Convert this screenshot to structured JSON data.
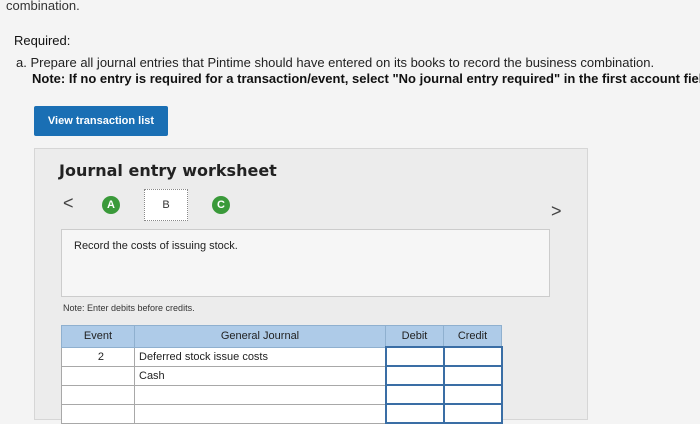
{
  "header": {
    "cut_text": "combination.",
    "required_title": "Required:",
    "item_a": "a. Prepare all journal entries that Pintime should have entered on its books to record the business combination.",
    "note": "Note: If no entry is required for a transaction/event, select \"No journal entry required\" in the first account field."
  },
  "buttons": {
    "view_transactions": "View transaction list"
  },
  "worksheet": {
    "title": "Journal entry worksheet",
    "nav_prev": "<",
    "nav_next": ">",
    "steps": [
      "A",
      "B",
      "C"
    ],
    "active_step": "B",
    "record_text": "Record the costs of issuing stock.",
    "note": "Note: Enter debits before credits."
  },
  "table": {
    "columns": [
      "Event",
      "General Journal",
      "Debit",
      "Credit"
    ],
    "rows": [
      {
        "event": "2",
        "account": "Deferred stock issue costs",
        "debit": "",
        "credit": ""
      },
      {
        "event": "",
        "account": "Cash",
        "debit": "",
        "credit": ""
      },
      {
        "event": "",
        "account": "",
        "debit": "",
        "credit": ""
      },
      {
        "event": "",
        "account": "",
        "debit": "",
        "credit": ""
      }
    ]
  },
  "colors": {
    "primary_button": "#1a6fb4",
    "step_complete": "#3a9a3a",
    "table_header": "#aecbe8"
  }
}
